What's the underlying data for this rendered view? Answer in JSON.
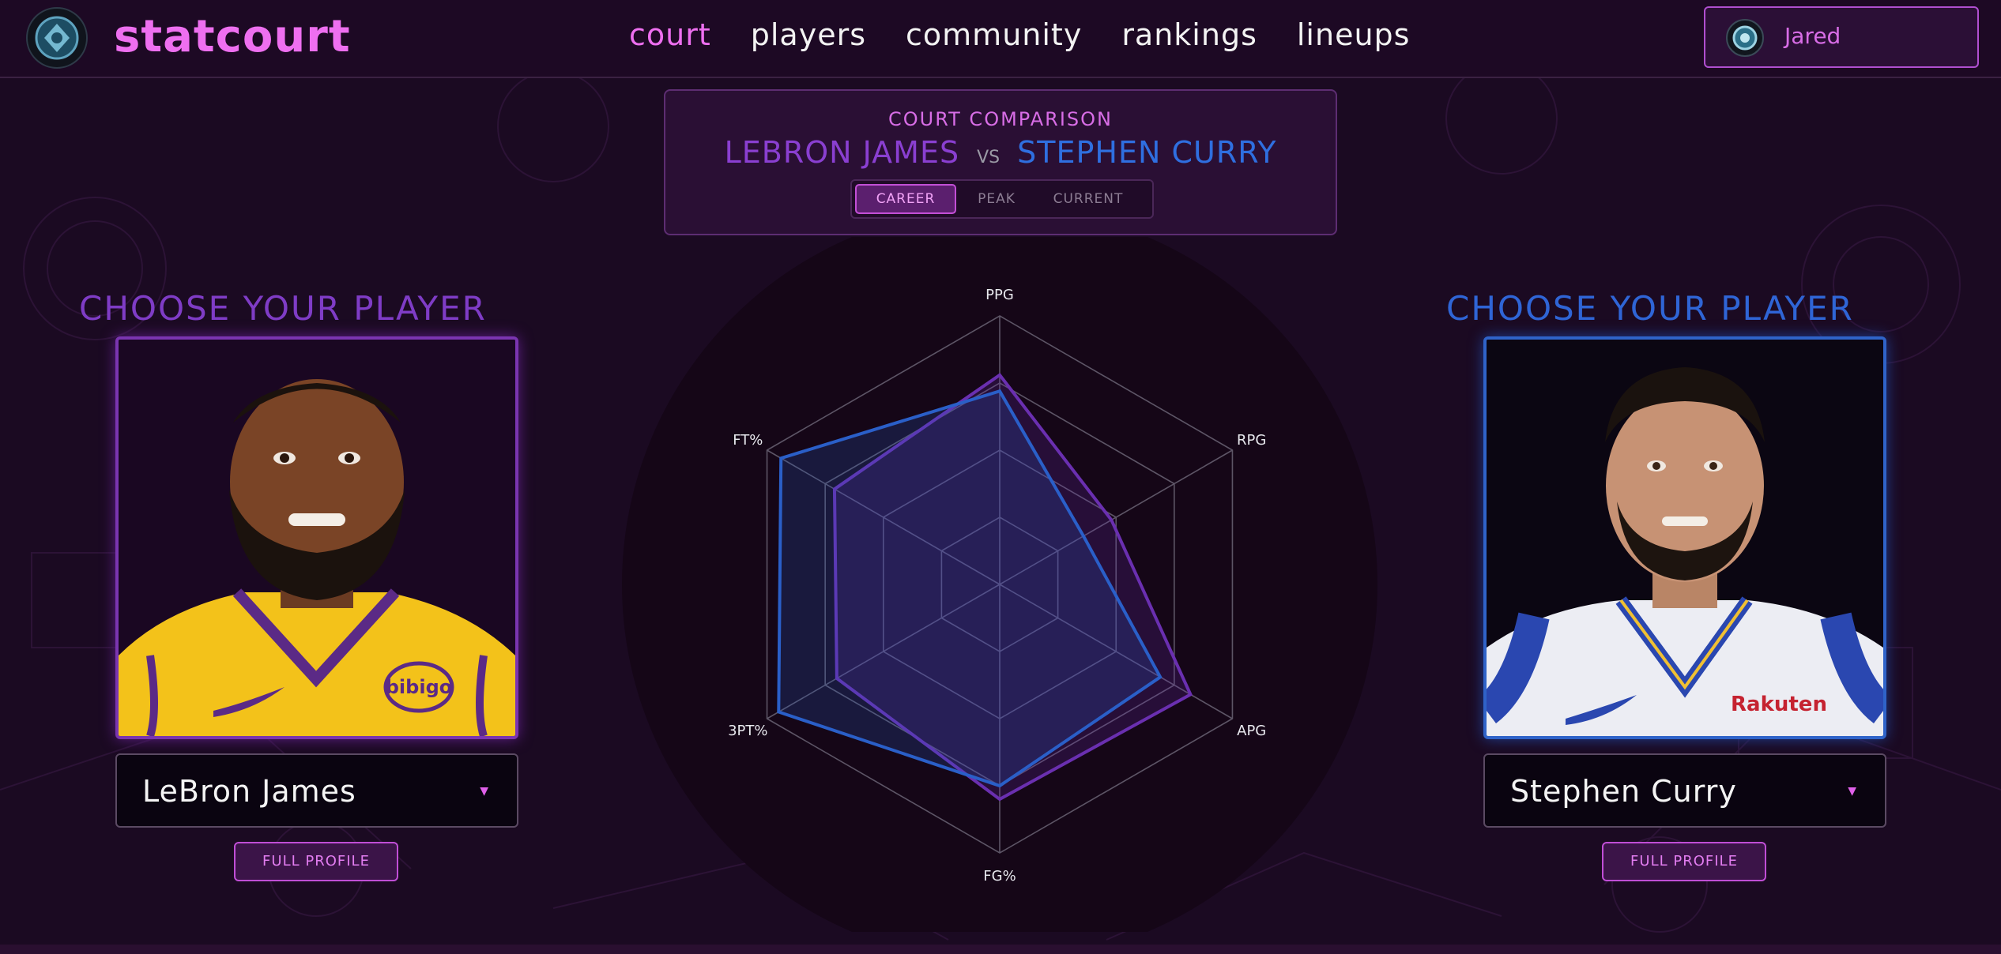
{
  "app": {
    "brand": "statcourt"
  },
  "nav": {
    "items": [
      "court",
      "players",
      "community",
      "rankings",
      "lineups"
    ],
    "active": "court"
  },
  "user": {
    "name": "Jared"
  },
  "comparison": {
    "title": "COURT COMPARISON",
    "player_a": "LEBRON JAMES",
    "vs": "VS",
    "player_b": "STEPHEN CURRY",
    "modes": [
      "CAREER",
      "PEAK",
      "CURRENT"
    ],
    "active_mode": "CAREER"
  },
  "left_player": {
    "heading": "CHOOSE YOUR PLAYER",
    "selected": "LeBron James",
    "profile_button": "FULL PROFILE",
    "jersey_sponsor": "bibigo",
    "color": "#7a35b0"
  },
  "right_player": {
    "heading": "CHOOSE YOUR PLAYER",
    "selected": "Stephen Curry",
    "profile_button": "FULL PROFILE",
    "jersey_sponsor": "Rakuten",
    "color": "#2f63c9"
  },
  "chart_data": {
    "type": "radar",
    "axes": [
      "PPG",
      "RPG",
      "APG",
      "FG%",
      "3PT%",
      "FT%"
    ],
    "range": [
      0,
      1
    ],
    "series": [
      {
        "name": "LeBron James",
        "color": "#6a2fb0",
        "values": [
          0.78,
          0.48,
          0.82,
          0.8,
          0.7,
          0.71
        ]
      },
      {
        "name": "Stephen Curry",
        "color": "#2a5fc8",
        "values": [
          0.72,
          0.36,
          0.69,
          0.75,
          0.95,
          0.94
        ]
      }
    ],
    "rings": 4
  }
}
